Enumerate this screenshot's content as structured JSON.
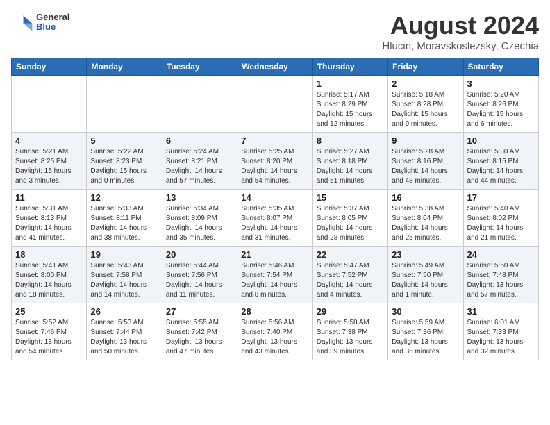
{
  "logo": {
    "general": "General",
    "blue": "Blue"
  },
  "header": {
    "title": "August 2024",
    "subtitle": "Hlucin, Moravskoslezsky, Czechia"
  },
  "days_of_week": [
    "Sunday",
    "Monday",
    "Tuesday",
    "Wednesday",
    "Thursday",
    "Friday",
    "Saturday"
  ],
  "weeks": [
    [
      {
        "day": "",
        "info": ""
      },
      {
        "day": "",
        "info": ""
      },
      {
        "day": "",
        "info": ""
      },
      {
        "day": "",
        "info": ""
      },
      {
        "day": "1",
        "info": "Sunrise: 5:17 AM\nSunset: 8:29 PM\nDaylight: 15 hours and 12 minutes."
      },
      {
        "day": "2",
        "info": "Sunrise: 5:18 AM\nSunset: 8:28 PM\nDaylight: 15 hours and 9 minutes."
      },
      {
        "day": "3",
        "info": "Sunrise: 5:20 AM\nSunset: 8:26 PM\nDaylight: 15 hours and 6 minutes."
      }
    ],
    [
      {
        "day": "4",
        "info": "Sunrise: 5:21 AM\nSunset: 8:25 PM\nDaylight: 15 hours and 3 minutes."
      },
      {
        "day": "5",
        "info": "Sunrise: 5:22 AM\nSunset: 8:23 PM\nDaylight: 15 hours and 0 minutes."
      },
      {
        "day": "6",
        "info": "Sunrise: 5:24 AM\nSunset: 8:21 PM\nDaylight: 14 hours and 57 minutes."
      },
      {
        "day": "7",
        "info": "Sunrise: 5:25 AM\nSunset: 8:20 PM\nDaylight: 14 hours and 54 minutes."
      },
      {
        "day": "8",
        "info": "Sunrise: 5:27 AM\nSunset: 8:18 PM\nDaylight: 14 hours and 51 minutes."
      },
      {
        "day": "9",
        "info": "Sunrise: 5:28 AM\nSunset: 8:16 PM\nDaylight: 14 hours and 48 minutes."
      },
      {
        "day": "10",
        "info": "Sunrise: 5:30 AM\nSunset: 8:15 PM\nDaylight: 14 hours and 44 minutes."
      }
    ],
    [
      {
        "day": "11",
        "info": "Sunrise: 5:31 AM\nSunset: 8:13 PM\nDaylight: 14 hours and 41 minutes."
      },
      {
        "day": "12",
        "info": "Sunrise: 5:33 AM\nSunset: 8:11 PM\nDaylight: 14 hours and 38 minutes."
      },
      {
        "day": "13",
        "info": "Sunrise: 5:34 AM\nSunset: 8:09 PM\nDaylight: 14 hours and 35 minutes."
      },
      {
        "day": "14",
        "info": "Sunrise: 5:35 AM\nSunset: 8:07 PM\nDaylight: 14 hours and 31 minutes."
      },
      {
        "day": "15",
        "info": "Sunrise: 5:37 AM\nSunset: 8:05 PM\nDaylight: 14 hours and 28 minutes."
      },
      {
        "day": "16",
        "info": "Sunrise: 5:38 AM\nSunset: 8:04 PM\nDaylight: 14 hours and 25 minutes."
      },
      {
        "day": "17",
        "info": "Sunrise: 5:40 AM\nSunset: 8:02 PM\nDaylight: 14 hours and 21 minutes."
      }
    ],
    [
      {
        "day": "18",
        "info": "Sunrise: 5:41 AM\nSunset: 8:00 PM\nDaylight: 14 hours and 18 minutes."
      },
      {
        "day": "19",
        "info": "Sunrise: 5:43 AM\nSunset: 7:58 PM\nDaylight: 14 hours and 14 minutes."
      },
      {
        "day": "20",
        "info": "Sunrise: 5:44 AM\nSunset: 7:56 PM\nDaylight: 14 hours and 11 minutes."
      },
      {
        "day": "21",
        "info": "Sunrise: 5:46 AM\nSunset: 7:54 PM\nDaylight: 14 hours and 8 minutes."
      },
      {
        "day": "22",
        "info": "Sunrise: 5:47 AM\nSunset: 7:52 PM\nDaylight: 14 hours and 4 minutes."
      },
      {
        "day": "23",
        "info": "Sunrise: 5:49 AM\nSunset: 7:50 PM\nDaylight: 14 hours and 1 minute."
      },
      {
        "day": "24",
        "info": "Sunrise: 5:50 AM\nSunset: 7:48 PM\nDaylight: 13 hours and 57 minutes."
      }
    ],
    [
      {
        "day": "25",
        "info": "Sunrise: 5:52 AM\nSunset: 7:46 PM\nDaylight: 13 hours and 54 minutes."
      },
      {
        "day": "26",
        "info": "Sunrise: 5:53 AM\nSunset: 7:44 PM\nDaylight: 13 hours and 50 minutes."
      },
      {
        "day": "27",
        "info": "Sunrise: 5:55 AM\nSunset: 7:42 PM\nDaylight: 13 hours and 47 minutes."
      },
      {
        "day": "28",
        "info": "Sunrise: 5:56 AM\nSunset: 7:40 PM\nDaylight: 13 hours and 43 minutes."
      },
      {
        "day": "29",
        "info": "Sunrise: 5:58 AM\nSunset: 7:38 PM\nDaylight: 13 hours and 39 minutes."
      },
      {
        "day": "30",
        "info": "Sunrise: 5:59 AM\nSunset: 7:36 PM\nDaylight: 13 hours and 36 minutes."
      },
      {
        "day": "31",
        "info": "Sunrise: 6:01 AM\nSunset: 7:33 PM\nDaylight: 13 hours and 32 minutes."
      }
    ]
  ]
}
